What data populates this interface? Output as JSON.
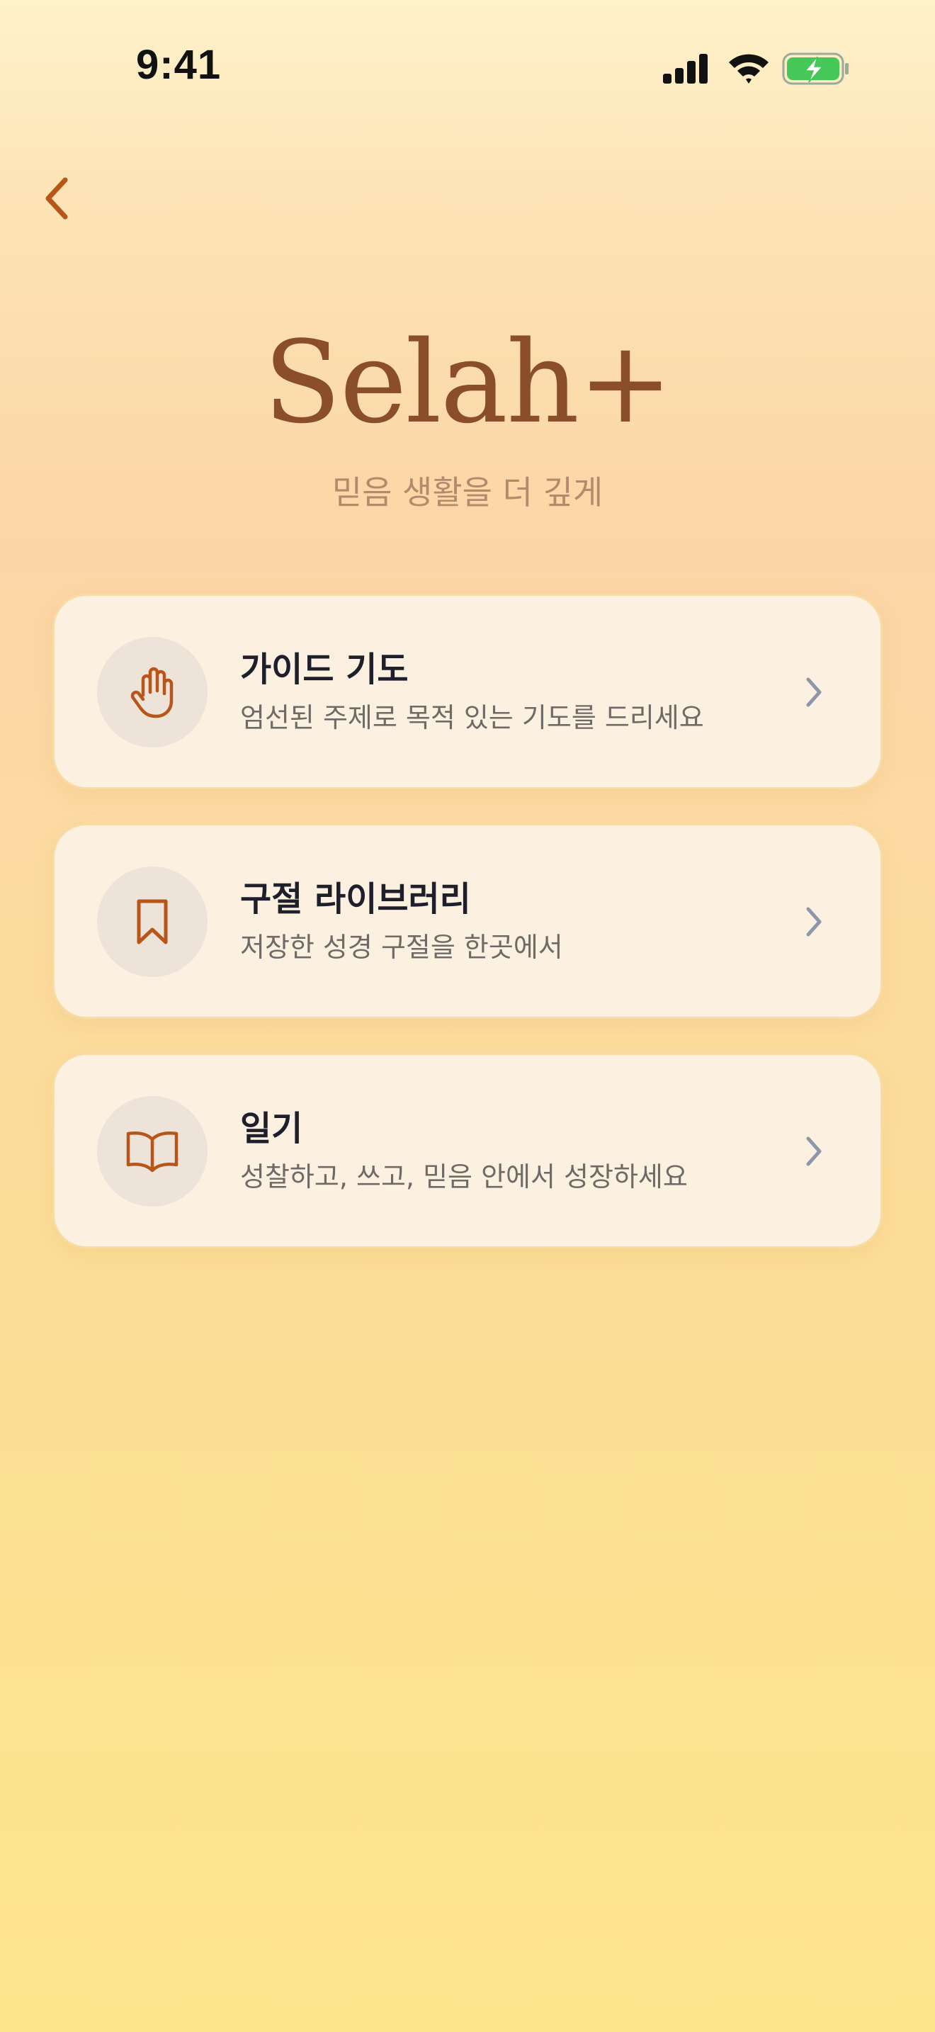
{
  "status_bar": {
    "time": "9:41",
    "icons": [
      "cellular-signal-icon",
      "wifi-icon",
      "battery-charging-icon"
    ]
  },
  "nav": {
    "back_icon": "chevron-left-icon"
  },
  "header": {
    "title": "Selah+",
    "subtitle": "믿음 생활을 더 깊게"
  },
  "menu": {
    "items": [
      {
        "title": "가이드 기도",
        "description": "엄선된 주제로 목적 있는 기도를 드리세요",
        "icon": "praying-hand-icon"
      },
      {
        "title": "구절 라이브러리",
        "description": "저장한 성경 구절을 한곳에서",
        "icon": "bookmark-icon"
      },
      {
        "title": "일기",
        "description": "성찰하고, 쓰고, 믿음 안에서 성장하세요",
        "icon": "open-book-icon"
      }
    ]
  },
  "colors": {
    "accent": "#B8561A",
    "title_brown": "#8A4E2B",
    "subtitle_tan": "#B5896B",
    "card_background": "#FCF0E0",
    "card_border": "#F8DCA6",
    "icon_circle": "#EDE3D8",
    "chevron_gray": "#8E97A8",
    "battery_green": "#46C858"
  }
}
